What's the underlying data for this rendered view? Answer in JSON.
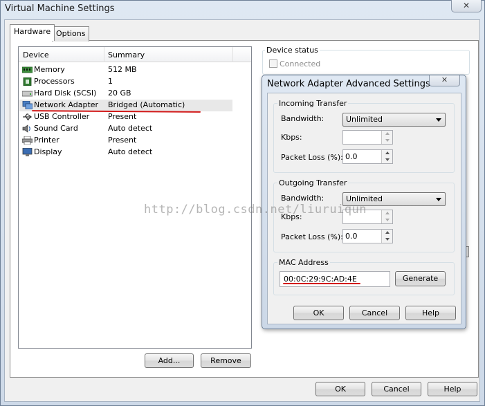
{
  "window": {
    "title": "Virtual Machine Settings",
    "close_glyph": "✕"
  },
  "tabs": [
    {
      "label": "Hardware",
      "active": true
    },
    {
      "label": "Options",
      "active": false
    }
  ],
  "device_list": {
    "headers": {
      "device": "Device",
      "summary": "Summary"
    },
    "rows": [
      {
        "icon": "memory-icon",
        "name": "Memory",
        "summary": "512 MB",
        "selected": false
      },
      {
        "icon": "processor-icon",
        "name": "Processors",
        "summary": "1",
        "selected": false
      },
      {
        "icon": "hard-disk-icon",
        "name": "Hard Disk (SCSI)",
        "summary": "20 GB",
        "selected": false
      },
      {
        "icon": "network-adapter-icon",
        "name": "Network Adapter",
        "summary": "Bridged (Automatic)",
        "selected": true
      },
      {
        "icon": "usb-icon",
        "name": "USB Controller",
        "summary": "Present",
        "selected": false
      },
      {
        "icon": "sound-card-icon",
        "name": "Sound Card",
        "summary": "Auto detect",
        "selected": false
      },
      {
        "icon": "printer-icon",
        "name": "Printer",
        "summary": "Present",
        "selected": false
      },
      {
        "icon": "display-icon",
        "name": "Display",
        "summary": "Auto detect",
        "selected": false
      }
    ],
    "add_button": "Add...",
    "remove_button": "Remove"
  },
  "device_status": {
    "label": "Device status",
    "connected_label": "Connected"
  },
  "bottom_buttons": {
    "ok": "OK",
    "cancel": "Cancel",
    "help": "Help"
  },
  "dialog": {
    "title": "Network Adapter Advanced Settings",
    "close_glyph": "✕",
    "incoming": {
      "label": "Incoming Transfer",
      "bandwidth_label": "Bandwidth:",
      "bandwidth_value": "Unlimited",
      "kbps_label": "Kbps:",
      "kbps_value": "",
      "packet_loss_label": "Packet Loss (%):",
      "packet_loss_value": "0.0"
    },
    "outgoing": {
      "label": "Outgoing Transfer",
      "bandwidth_label": "Bandwidth:",
      "bandwidth_value": "Unlimited",
      "kbps_label": "Kbps:",
      "kbps_value": "",
      "packet_loss_label": "Packet Loss (%):",
      "packet_loss_value": "0.0"
    },
    "mac": {
      "label": "MAC Address",
      "value": "00:0C:29:9C:AD:4E",
      "generate_button": "Generate"
    },
    "buttons": {
      "ok": "OK",
      "cancel": "Cancel",
      "help": "Help"
    }
  },
  "watermark": "http://blog.csdn.net/liuruiqun",
  "colors": {
    "annotation_red": "#d21818",
    "window_frame": "#dfe8f3",
    "selection": "#e8e8e8"
  }
}
